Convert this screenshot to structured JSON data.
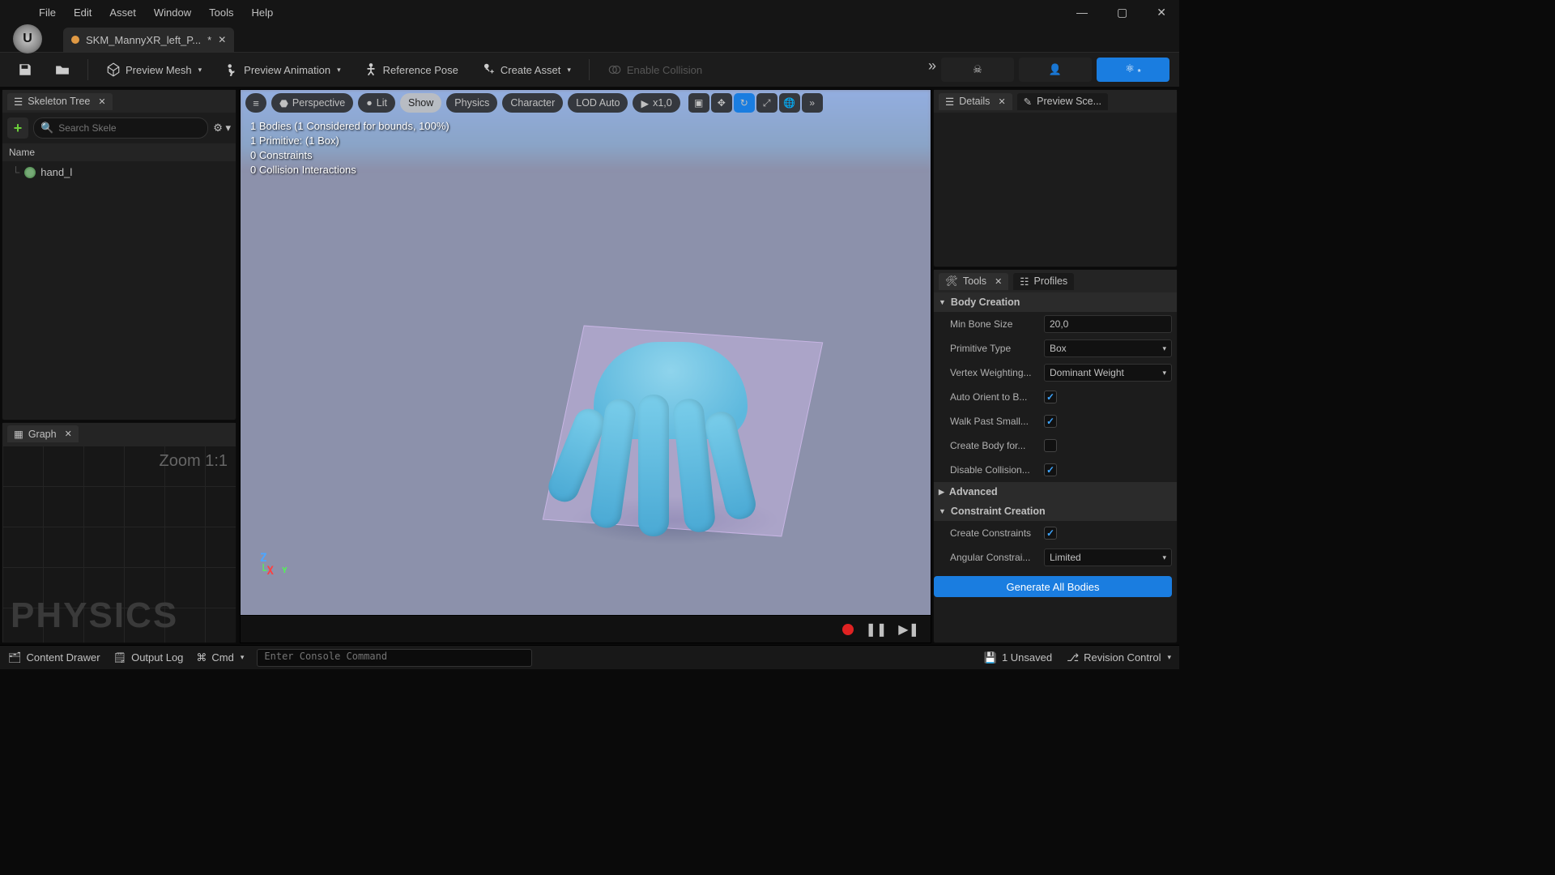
{
  "menus": [
    "File",
    "Edit",
    "Asset",
    "Window",
    "Tools",
    "Help"
  ],
  "tab": {
    "name": "SKM_MannyXR_left_P...",
    "dirty": "*"
  },
  "toolbar": {
    "preview_mesh": "Preview Mesh",
    "preview_anim": "Preview Animation",
    "reference_pose": "Reference Pose",
    "create_asset": "Create Asset",
    "enable_collision": "Enable Collision"
  },
  "skeleton": {
    "title": "Skeleton Tree",
    "search_placeholder": "Search Skele",
    "column": "Name",
    "root": "hand_l"
  },
  "graph": {
    "title": "Graph",
    "zoom": "Zoom 1:1",
    "watermark": "PHYSICS"
  },
  "viewport": {
    "perspective": "Perspective",
    "lit": "Lit",
    "show": "Show",
    "physics": "Physics",
    "character": "Character",
    "lod": "LOD Auto",
    "speed": "x1,0",
    "stats": [
      "1 Bodies (1 Considered for bounds, 100%)",
      "1 Primitive: (1 Box)",
      "0 Constraints",
      "0 Collision Interactions"
    ],
    "axis_z": "Z",
    "axis_x": "X"
  },
  "details": {
    "title": "Details",
    "preview": "Preview Sce..."
  },
  "tools": {
    "title": "Tools",
    "profiles": "Profiles",
    "body_creation": "Body Creation",
    "min_bone_size_label": "Min Bone Size",
    "min_bone_size_value": "20,0",
    "primitive_type_label": "Primitive Type",
    "primitive_type_value": "Box",
    "vertex_weighting_label": "Vertex Weighting...",
    "vertex_weighting_value": "Dominant Weight",
    "auto_orient_label": "Auto Orient to B...",
    "walk_past_label": "Walk Past Small...",
    "create_body_label": "Create Body for...",
    "disable_collision_label": "Disable Collision...",
    "advanced": "Advanced",
    "constraint_creation": "Constraint Creation",
    "create_constraints_label": "Create Constraints",
    "angular_constraint_label": "Angular Constrai...",
    "angular_constraint_value": "Limited",
    "generate": "Generate All Bodies"
  },
  "status": {
    "content_drawer": "Content Drawer",
    "output_log": "Output Log",
    "cmd": "Cmd",
    "cmd_placeholder": "Enter Console Command",
    "unsaved": "1 Unsaved",
    "revision": "Revision Control"
  }
}
